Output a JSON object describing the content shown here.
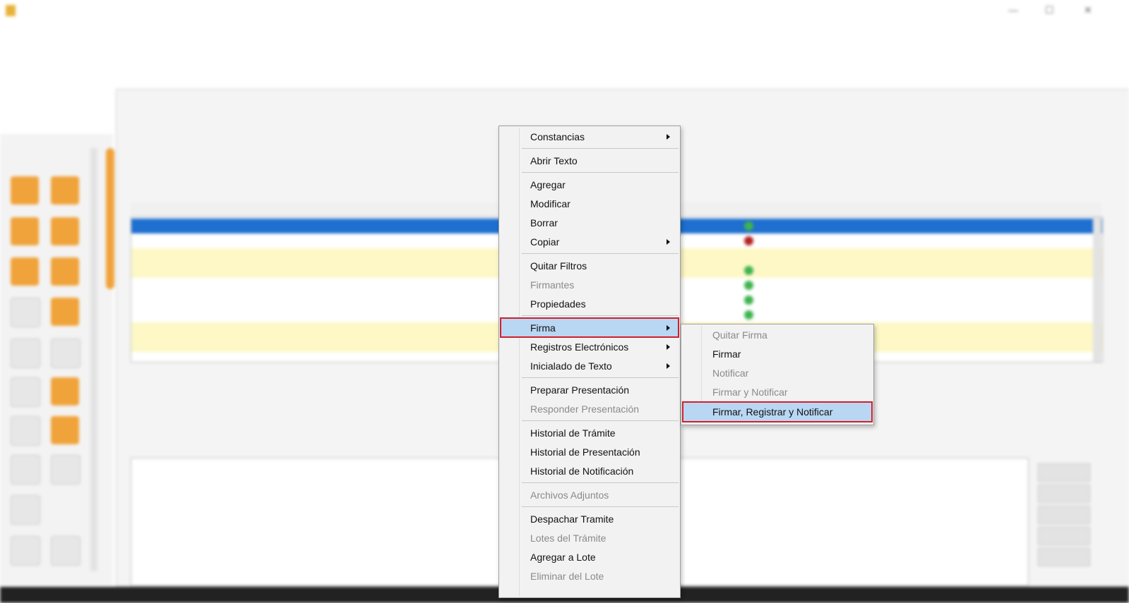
{
  "context_menu": {
    "items": [
      {
        "label": "Constancias",
        "submenu": true,
        "disabled": false
      },
      {
        "label": "Abrir Texto",
        "submenu": false,
        "disabled": false
      },
      {
        "label": "Agregar",
        "submenu": false,
        "disabled": false
      },
      {
        "label": "Modificar",
        "submenu": false,
        "disabled": false
      },
      {
        "label": "Borrar",
        "submenu": false,
        "disabled": false
      },
      {
        "label": "Copiar",
        "submenu": true,
        "disabled": false
      },
      {
        "label": "Quitar Filtros",
        "submenu": false,
        "disabled": false
      },
      {
        "label": "Firmantes",
        "submenu": false,
        "disabled": true
      },
      {
        "label": "Propiedades",
        "submenu": false,
        "disabled": false
      },
      {
        "label": "Firma",
        "submenu": true,
        "disabled": false,
        "highlighted": true
      },
      {
        "label": "Registros Electrónicos",
        "submenu": true,
        "disabled": false
      },
      {
        "label": "Inicialado de Texto",
        "submenu": true,
        "disabled": false
      },
      {
        "label": "Preparar Presentación",
        "submenu": false,
        "disabled": false
      },
      {
        "label": "Responder Presentación",
        "submenu": false,
        "disabled": true
      },
      {
        "label": "Historial de Trámite",
        "submenu": false,
        "disabled": false
      },
      {
        "label": "Historial de Presentación",
        "submenu": false,
        "disabled": false
      },
      {
        "label": "Historial de Notificación",
        "submenu": false,
        "disabled": false
      },
      {
        "label": "Archivos Adjuntos",
        "submenu": false,
        "disabled": true
      },
      {
        "label": "Despachar Tramite",
        "submenu": false,
        "disabled": false
      },
      {
        "label": "Lotes del Trámite",
        "submenu": false,
        "disabled": true
      },
      {
        "label": "Agregar a Lote",
        "submenu": false,
        "disabled": false
      },
      {
        "label": "Eliminar del Lote",
        "submenu": false,
        "disabled": true
      }
    ]
  },
  "firma_submenu": {
    "items": [
      {
        "label": "Quitar Firma",
        "disabled": true
      },
      {
        "label": "Firmar",
        "disabled": false
      },
      {
        "label": "Notificar",
        "disabled": true
      },
      {
        "label": "Firmar y Notificar",
        "disabled": true
      },
      {
        "label": "Firmar, Registrar y Notificar",
        "disabled": false,
        "highlighted": true
      }
    ]
  },
  "colors": {
    "highlight": "#b9d6f3",
    "callout_border": "#d21f2b",
    "selected_row": "#1e6fd0",
    "toolbar_tile": "#f0a33a"
  }
}
